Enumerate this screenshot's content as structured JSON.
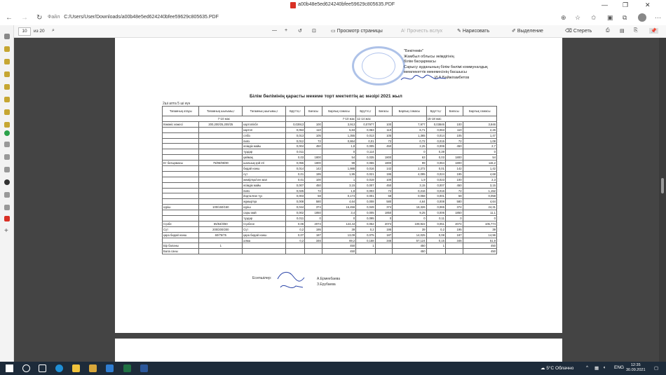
{
  "window": {
    "doc_title": "a00b48e5ed624240bfee59629c805635.PDF"
  },
  "addressbar": {
    "scheme_label": "Файл",
    "url": "C:/Users/User/Downloads/a00b48e5ed624240bfee59629c805635.PDF"
  },
  "pdf_toolbar": {
    "page_current": "10",
    "page_total": "из 20",
    "page_view": "Просмотр страницы",
    "read_aloud": "Прочесть вслух",
    "draw": "Нарисовать",
    "highlight": "Выделение",
    "erase": "Стереть"
  },
  "document": {
    "approve_lines": [
      "\"Бекітемін\"",
      "Жамбыл облысы  әкімдігінің",
      "білім басқармасы",
      "Сарысу ауданының білім бөлімі коммуналдық",
      "мемлекеттік мекемесінің басшысы",
      "И.А.Байжігамбетов"
    ],
    "heading": "Білім бөлімінің қарасты мекеме торт мектептің ас мәзірі 2021 жыл",
    "subheading": "2ші апта 5 ші күн",
    "headers": [
      "Тағамның атауы",
      "Тағамның шығымы,г",
      "Тағамның шығымы,г",
      "Брутто,г",
      "Бағасы",
      "Барлық сомасы",
      "Брутто,г",
      "Бағасы",
      "Барлық сомасы",
      "Брутто,г",
      "Бағасы",
      "Барлық сомасы"
    ],
    "age_groups": [
      "7-10 жас",
      "7-10 жас",
      "11-14 жас",
      "15-18 жас"
    ],
    "rows": [
      [
        "Көкөніс көжесі",
        "200,200/25,200/25",
        "картоп/кбл",
        "0,03913",
        "100",
        "3,913",
        "0,07977",
        "100",
        "7,977",
        "0,03846",
        "100",
        "3,846"
      ],
      [
        "",
        "",
        "картоп",
        "0,053",
        "110",
        "5,83",
        "0,063",
        "110",
        "6,71",
        "0,063",
        "110",
        "2,26"
      ],
      [
        "",
        "",
        "сәбіз",
        "0,013",
        "105",
        "1,355",
        "0,013",
        "105",
        "1,365",
        "0,014",
        "105",
        "1,47"
      ],
      [
        "",
        "",
        "пияз",
        "0,012",
        "72",
        "0,864",
        "0,01",
        "72",
        "0,72",
        "0,015",
        "72",
        "1,08"
      ],
      [
        "",
        "",
        "өсімдік майы",
        "0,004",
        "450",
        "1,8",
        "0,005",
        "450",
        "2,25",
        "0,006",
        "450",
        "2,7"
      ],
      [
        "",
        "",
        "тұздар",
        "0,011",
        "",
        "0",
        "0,114",
        "",
        "0",
        "0,39",
        "",
        "0"
      ],
      [
        "",
        "",
        "қаймақ",
        "0,03",
        "1800",
        "54",
        "0,035",
        "1800",
        "63",
        "0,03",
        "1800",
        "54"
      ],
      [
        "Ет батырмасы",
        "75/85/95/90",
        "шалшық қой еті",
        "0,055",
        "1800",
        "99",
        "0,055",
        "1800",
        "99",
        "0,064",
        "1800",
        "115,2"
      ],
      [
        "",
        "",
        "бидай нанш",
        "0,014",
        "142",
        "1,988",
        "0,016",
        "142",
        "2,272",
        "0,01",
        "142",
        "1,42"
      ],
      [
        "",
        "",
        "сүт",
        "0,01",
        "195",
        "1,95",
        "0,021",
        "195",
        "4,095",
        "0,024",
        "195",
        "4,68"
      ],
      [
        "",
        "",
        "жеміртқа/сен мал",
        "0,01",
        "100",
        "1",
        "0,019",
        "100",
        "1,9",
        "0,023",
        "100",
        "2,3"
      ],
      [
        "",
        "",
        "өсімдік майы",
        "0,007",
        "450",
        "3,15",
        "0,007",
        "450",
        "3,15",
        "0,007",
        "450",
        "3,15"
      ],
      [
        "",
        "",
        "пияз",
        "0,025",
        "72",
        "1,8",
        "0,003",
        "72",
        "0,216",
        "0,016",
        "72",
        "1,152"
      ],
      [
        "",
        "",
        "йодталған тұз",
        "0,003",
        "58",
        "0,174",
        "0,001",
        "58",
        "0,058",
        "0,001",
        "58",
        "0,058"
      ],
      [
        "",
        "",
        "жұмыртқа",
        "0,008",
        "580",
        "4,64",
        "0,008",
        "580",
        "4,64",
        "0,008",
        "580",
        "4,64"
      ],
      [
        "күріш",
        "100/150/150",
        "күріш",
        "0,044",
        "374",
        "16,456",
        "0,049",
        "374",
        "18,326",
        "0,065",
        "374",
        "24,31"
      ],
      [
        "",
        "",
        "сары май",
        "0,002",
        "1850",
        "3,4",
        "0,005",
        "1850",
        "9,25",
        "0,006",
        "1850",
        "11,1"
      ],
      [
        "",
        "",
        "тұздар",
        "0,011",
        "0",
        "0",
        "0,095",
        "0",
        "0",
        "0,11",
        "0",
        "0"
      ],
      [
        "Сүзбе",
        "65/53/3/60",
        "Сүзбесе",
        "0,06",
        "2074",
        "124,44",
        "0,052",
        "2074",
        "109,922",
        "0,051",
        "2074",
        "105,774"
      ],
      [
        "Сүт",
        "200/200/200",
        "Сүт",
        "0,2",
        "195",
        "39",
        "0,2",
        "195",
        "39",
        "0,2",
        "195",
        "39"
      ],
      [
        "қара бидай нанш",
        "60/75/75",
        "қара бидай нанш",
        "0,07",
        "187",
        "13,09",
        "0,075",
        "187",
        "14,025",
        "0,08",
        "187",
        "14,96"
      ],
      [
        "",
        "",
        "алма",
        "0,2",
        "346",
        "69,2",
        "0,158",
        "346",
        "57,124",
        "0,15",
        "346",
        "51,9"
      ],
      [
        "Бір баланы",
        "1",
        "",
        "",
        "",
        "450",
        "1",
        "",
        "450",
        "1",
        "",
        "450"
      ],
      [
        "Бала саны",
        "",
        "",
        "",
        "",
        "450",
        "",
        "",
        "450",
        "",
        "",
        "450"
      ]
    ],
    "signers_label": "Есепшілер:",
    "signer_names": [
      "А.Ермекбаева",
      "З.Ерубаева"
    ]
  },
  "taskbar": {
    "weather": "5°C  Облачно",
    "lang": "ENG",
    "time": "12:35",
    "date": "30.09.2021"
  },
  "colors": {
    "stamp": "#6b8fd6",
    "taskbar": "#1d2b3a",
    "pdf_red": "#d93025"
  }
}
